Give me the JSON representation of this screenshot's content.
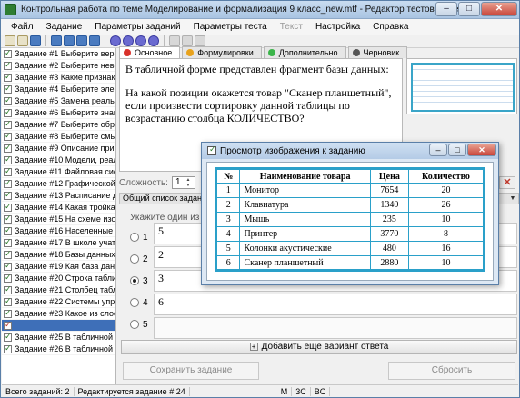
{
  "window": {
    "title": "Контрольная работа по теме Моделирование и формализация 9 класс_new.mtf - Редактор тестов MyTestX",
    "buttons": {
      "minimize": "–",
      "maximize": "□",
      "close": "✕"
    }
  },
  "menu": [
    "Файл",
    "Задание",
    "Параметры заданий",
    "Параметры теста",
    "Текст",
    "Настройка",
    "Справка"
  ],
  "sidebar": {
    "items": [
      {
        "label": "Задание #1 Выберите вер",
        "selected": false
      },
      {
        "label": "Задание #2 Выберите неве",
        "selected": false
      },
      {
        "label": "Задание #3 Какие признак",
        "selected": false
      },
      {
        "label": "Задание #4 Выберите элем",
        "selected": false
      },
      {
        "label": "Задание #5 Замена реальн",
        "selected": false
      },
      {
        "label": "Задание #6 Выберите знак",
        "selected": false
      },
      {
        "label": "Задание #7 Выберите обр",
        "selected": false
      },
      {
        "label": "Задание #8 Выберите смы",
        "selected": false
      },
      {
        "label": "Задание #9 Описание прир",
        "selected": false
      },
      {
        "label": "Задание #10 Модели, реал",
        "selected": false
      },
      {
        "label": "Задание #11 Файловая сис",
        "selected": false
      },
      {
        "label": "Задание #12 Графической",
        "selected": false
      },
      {
        "label": "Задание #13 Расписание д",
        "selected": false
      },
      {
        "label": "Задание #14 Какая тройка",
        "selected": false
      },
      {
        "label": "Задание #15 На схеме изоб",
        "selected": false
      },
      {
        "label": "Задание #16 Населенные п",
        "selected": false
      },
      {
        "label": "Задание #17 В школе учат",
        "selected": false
      },
      {
        "label": "Задание #18 Базы данных",
        "selected": false
      },
      {
        "label": "Задание #19 Кая база дан",
        "selected": false
      },
      {
        "label": "Задание #20 Строка таблиц",
        "selected": false
      },
      {
        "label": "Задание #21 Столбец табли",
        "selected": false
      },
      {
        "label": "Задание #22 Системы упр",
        "selected": false
      },
      {
        "label": "Задание #23 Какое из слое",
        "selected": false
      },
      {
        "label": "",
        "selected": true
      },
      {
        "label": "Задание #25 В табличной",
        "selected": false
      },
      {
        "label": "Задание #26 В табличной",
        "selected": false
      }
    ]
  },
  "tabs": [
    {
      "label": "Основное",
      "color": "#d9312a",
      "active": true
    },
    {
      "label": "Формулировки",
      "color": "#e8a21c",
      "active": false
    },
    {
      "label": "Дополнительно",
      "color": "#3bb54a",
      "active": false
    },
    {
      "label": "Черновик",
      "color": "#555555",
      "active": false
    }
  ],
  "question": {
    "p1": "В табличной форме представлен фрагмент базы данных:",
    "p2": "На какой позиции окажется товар \"Сканер планшетный\", если произвести сортировку данной таблицы по возрастанию столбца КОЛИЧЕСТВО?"
  },
  "difficulty": {
    "label": "Сложность:",
    "value": "1"
  },
  "list_bar": "Общий список заданий",
  "hint": "Укажите один из ва",
  "answers": [
    {
      "num": "1",
      "text": "5",
      "checked": false
    },
    {
      "num": "2",
      "text": "2",
      "checked": false
    },
    {
      "num": "3",
      "text": "3",
      "checked": true
    },
    {
      "num": "4",
      "text": "6",
      "checked": false
    },
    {
      "num": "5",
      "text": "",
      "checked": false
    }
  ],
  "buttons": {
    "add": "Добавить еще вариант ответа",
    "save": "Сохранить задание",
    "reset": "Сбросить"
  },
  "status": {
    "total": "Всего заданий: 2",
    "editing": "Редактируется задание # 24",
    "m": "M",
    "caps": "3C",
    "bc": "BC"
  },
  "popup": {
    "title": "Просмотр изображения к заданию",
    "headers": [
      "№",
      "Наименование товара",
      "Цена",
      "Количество"
    ],
    "rows": [
      [
        "1",
        "Монитор",
        "7654",
        "20"
      ],
      [
        "2",
        "Клавиатура",
        "1340",
        "26"
      ],
      [
        "3",
        "Мышь",
        "235",
        "10"
      ],
      [
        "4",
        "Принтер",
        "3770",
        "8"
      ],
      [
        "5",
        "Колонки акустические",
        "480",
        "16"
      ],
      [
        "6",
        "Сканер планшетный",
        "2880",
        "10"
      ]
    ]
  }
}
